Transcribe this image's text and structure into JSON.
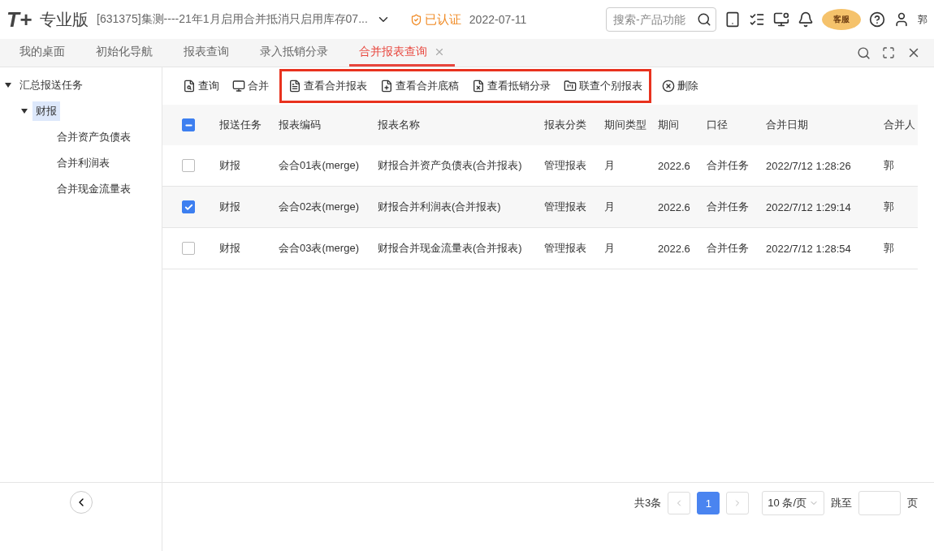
{
  "header": {
    "logo": "T+",
    "edition": "专业版",
    "account": "[631375]集测----21年1月启用合并抵消只启用库存07...",
    "certified": "已认证",
    "date": "2022-07-11",
    "search": {
      "placeholder": "搜索-产品功能"
    },
    "service_badge": "客服",
    "user": "郭"
  },
  "tabs": [
    {
      "label": "我的桌面",
      "selected": false,
      "closable": false
    },
    {
      "label": "初始化导航",
      "selected": false,
      "closable": false
    },
    {
      "label": "报表查询",
      "selected": false,
      "closable": false
    },
    {
      "label": "录入抵销分录",
      "selected": false,
      "closable": false
    },
    {
      "label": "合并报表查询",
      "selected": true,
      "closable": true
    }
  ],
  "sidebar": {
    "items": [
      {
        "label": "汇总报送任务",
        "expanded": true,
        "selected": false,
        "children": [
          {
            "label": "财报",
            "expanded": true,
            "selected": true,
            "children": [
              {
                "label": "合并资产负债表",
                "selected": false
              },
              {
                "label": "合并利润表",
                "selected": false
              },
              {
                "label": "合并现金流量表",
                "selected": false
              }
            ]
          }
        ]
      }
    ]
  },
  "toolbar": [
    {
      "highlighted": false,
      "buttons": [
        "查询",
        "合并"
      ]
    },
    {
      "highlighted": true,
      "buttons": [
        "查看合并报表",
        "查看合并底稿",
        "查看抵销分录",
        "联查个别报表"
      ]
    },
    {
      "highlighted": false,
      "buttons": [
        "删除"
      ]
    }
  ],
  "table": {
    "select_all": {
      "indeterminate": true
    },
    "columns": [
      "报送任务",
      "报表编码",
      "报表名称",
      "报表分类",
      "期间类型",
      "期间",
      "口径",
      "合并日期",
      "合并人"
    ],
    "rows": [
      {
        "checked": false,
        "cells": [
          "财报",
          "会合01表(merge)",
          "财报合并资产负债表(合并报表)",
          "管理报表",
          "月",
          "2022.6",
          "合并任务",
          "2022/7/12 1:28:26",
          "郭"
        ]
      },
      {
        "checked": true,
        "cells": [
          "财报",
          "会合02表(merge)",
          "财报合并利润表(合并报表)",
          "管理报表",
          "月",
          "2022.6",
          "合并任务",
          "2022/7/12 1:29:14",
          "郭"
        ]
      },
      {
        "checked": false,
        "cells": [
          "财报",
          "会合03表(merge)",
          "财报合并现金流量表(合并报表)",
          "管理报表",
          "月",
          "2022.6",
          "合并任务",
          "2022/7/12 1:28:54",
          "郭"
        ]
      }
    ]
  },
  "pagination": {
    "total": "共3条",
    "pages": [
      {
        "label": "1",
        "selected": true
      }
    ],
    "page_size": "10 条/页",
    "jump_label": "跳至",
    "page_unit": "页"
  }
}
